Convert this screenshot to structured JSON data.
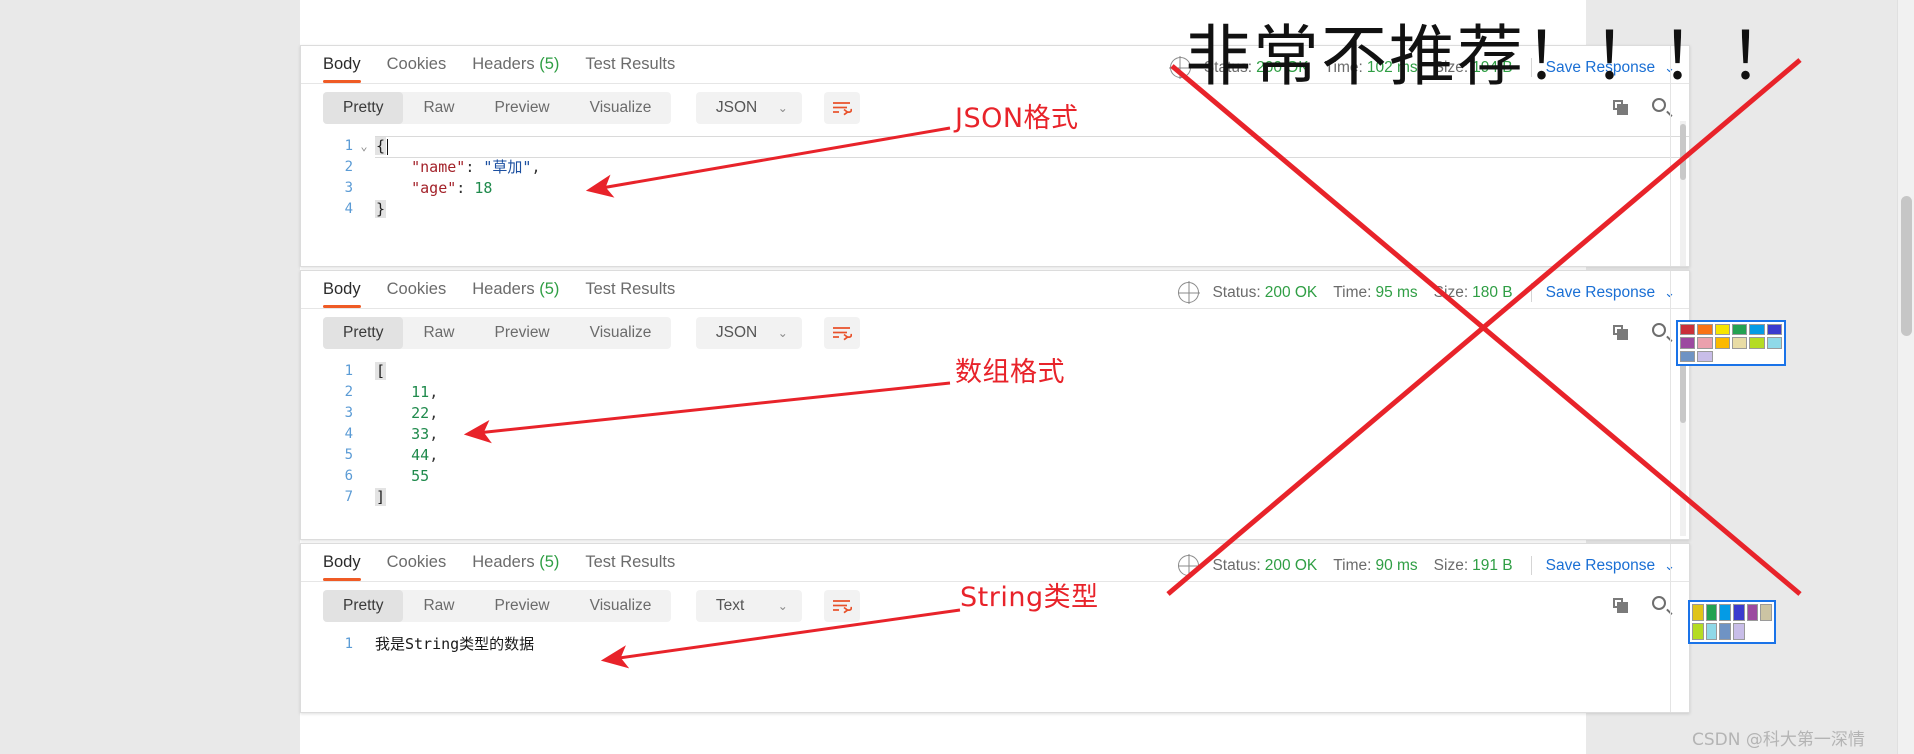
{
  "overlay": {
    "big_text": "非常不推荐！！！！",
    "watermark": "CSDN @科大第一深情"
  },
  "annotations": [
    {
      "label": "JSON格式"
    },
    {
      "label": "数组格式"
    },
    {
      "label": "String类型"
    }
  ],
  "panels": [
    {
      "id": "json-panel",
      "tabs": [
        {
          "label": "Body",
          "active": true
        },
        {
          "label": "Cookies",
          "active": false
        },
        {
          "label": "Headers",
          "count": "(5)",
          "active": false
        },
        {
          "label": "Test Results",
          "active": false
        }
      ],
      "status": {
        "status_label": "Status:",
        "status_value": "200 OK",
        "time_label": "Time:",
        "time_value": "102 ms",
        "size_label": "Size:",
        "size_value": "194 B",
        "save_response": "Save Response"
      },
      "toolbar": {
        "views": [
          {
            "label": "Pretty",
            "active": true
          },
          {
            "label": "Raw",
            "active": false
          },
          {
            "label": "Preview",
            "active": false
          },
          {
            "label": "Visualize",
            "active": false
          }
        ],
        "format": "JSON"
      },
      "code": {
        "language": "json",
        "lines": [
          {
            "n": "1",
            "fold": "⌄",
            "tokens": [
              {
                "t": "brace",
                "v": "{"
              },
              {
                "t": "caret",
                "v": ""
              }
            ]
          },
          {
            "n": "2",
            "fold": "",
            "tokens": [
              {
                "t": "plain",
                "v": "    "
              },
              {
                "t": "key",
                "v": "\"name\""
              },
              {
                "t": "punct",
                "v": ": "
              },
              {
                "t": "str",
                "v": "\"草加\""
              },
              {
                "t": "punct",
                "v": ","
              }
            ]
          },
          {
            "n": "3",
            "fold": "",
            "tokens": [
              {
                "t": "plain",
                "v": "    "
              },
              {
                "t": "key",
                "v": "\"age\""
              },
              {
                "t": "punct",
                "v": ": "
              },
              {
                "t": "num",
                "v": "18"
              }
            ]
          },
          {
            "n": "4",
            "fold": "",
            "tokens": [
              {
                "t": "brace",
                "v": "}"
              }
            ]
          }
        ]
      }
    },
    {
      "id": "array-panel",
      "tabs": [
        {
          "label": "Body",
          "active": true
        },
        {
          "label": "Cookies",
          "active": false
        },
        {
          "label": "Headers",
          "count": "(5)",
          "active": false
        },
        {
          "label": "Test Results",
          "active": false
        }
      ],
      "status": {
        "status_label": "Status:",
        "status_value": "200 OK",
        "time_label": "Time:",
        "time_value": "95 ms",
        "size_label": "Size:",
        "size_value": "180 B",
        "save_response": "Save Response"
      },
      "toolbar": {
        "views": [
          {
            "label": "Pretty",
            "active": true
          },
          {
            "label": "Raw",
            "active": false
          },
          {
            "label": "Preview",
            "active": false
          },
          {
            "label": "Visualize",
            "active": false
          }
        ],
        "format": "JSON"
      },
      "code": {
        "language": "json",
        "lines": [
          {
            "n": "1",
            "fold": "",
            "tokens": [
              {
                "t": "brace",
                "v": "["
              }
            ]
          },
          {
            "n": "2",
            "fold": "",
            "tokens": [
              {
                "t": "plain",
                "v": "    "
              },
              {
                "t": "num",
                "v": "11"
              },
              {
                "t": "punct",
                "v": ","
              }
            ]
          },
          {
            "n": "3",
            "fold": "",
            "tokens": [
              {
                "t": "plain",
                "v": "    "
              },
              {
                "t": "num",
                "v": "22"
              },
              {
                "t": "punct",
                "v": ","
              }
            ]
          },
          {
            "n": "4",
            "fold": "",
            "tokens": [
              {
                "t": "plain",
                "v": "    "
              },
              {
                "t": "num",
                "v": "33"
              },
              {
                "t": "punct",
                "v": ","
              }
            ]
          },
          {
            "n": "5",
            "fold": "",
            "tokens": [
              {
                "t": "plain",
                "v": "    "
              },
              {
                "t": "num",
                "v": "44"
              },
              {
                "t": "punct",
                "v": ","
              }
            ]
          },
          {
            "n": "6",
            "fold": "",
            "tokens": [
              {
                "t": "plain",
                "v": "    "
              },
              {
                "t": "num",
                "v": "55"
              }
            ]
          },
          {
            "n": "7",
            "fold": "",
            "tokens": [
              {
                "t": "brace",
                "v": "]"
              }
            ]
          }
        ]
      }
    },
    {
      "id": "string-panel",
      "tabs": [
        {
          "label": "Body",
          "active": true
        },
        {
          "label": "Cookies",
          "active": false
        },
        {
          "label": "Headers",
          "count": "(5)",
          "active": false
        },
        {
          "label": "Test Results",
          "active": false
        }
      ],
      "status": {
        "status_label": "Status:",
        "status_value": "200 OK",
        "time_label": "Time:",
        "time_value": "90 ms",
        "size_label": "Size:",
        "size_value": "191 B",
        "save_response": "Save Response"
      },
      "toolbar": {
        "views": [
          {
            "label": "Pretty",
            "active": true
          },
          {
            "label": "Raw",
            "active": false
          },
          {
            "label": "Preview",
            "active": false
          },
          {
            "label": "Visualize",
            "active": false
          }
        ],
        "format": "Text"
      },
      "code": {
        "language": "text",
        "lines": [
          {
            "n": "1",
            "fold": "",
            "tokens": [
              {
                "t": "plain",
                "v": "我是String类型的数据"
              }
            ]
          }
        ]
      }
    }
  ],
  "palettes": [
    {
      "id": "palette-top",
      "colors": [
        "#c9303a",
        "#f97316",
        "#f6e500",
        "#24a251",
        "#049be5",
        "#3b3bce",
        "#9c4aa0",
        "#eba0ad",
        "#fcb900",
        "#e8dca5",
        "#b5dc23",
        "#8fd9e8",
        "#6f93c4",
        "#c8bde8"
      ]
    },
    {
      "id": "palette-bottom",
      "colors": [
        "#e0c419",
        "#24a251",
        "#049be5",
        "#3b3bce",
        "#9c4aa0",
        "#ccc4a3",
        "#b5dc23",
        "#8fd9e8",
        "#6f93c4",
        "#c8bde8"
      ]
    }
  ],
  "colors": {
    "accent_orange": "#ef5b25",
    "link_blue": "#1a6fd4",
    "status_green": "#2f9e44",
    "annotation_red": "#e8232a",
    "palette_border_blue": "#1a73e8"
  }
}
